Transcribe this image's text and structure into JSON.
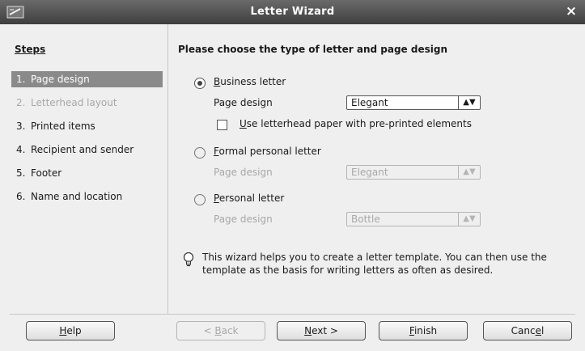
{
  "window": {
    "title": "Letter Wizard",
    "close_icon": "×"
  },
  "steps": {
    "heading": "Steps",
    "items": [
      {
        "num": "1.",
        "label": "Page design",
        "state": "active"
      },
      {
        "num": "2.",
        "label": "Letterhead layout",
        "state": "disabled"
      },
      {
        "num": "3.",
        "label": "Printed items",
        "state": "normal"
      },
      {
        "num": "4.",
        "label": "Recipient and sender",
        "state": "normal"
      },
      {
        "num": "5.",
        "label": "Footer",
        "state": "normal"
      },
      {
        "num": "6.",
        "label": "Name and location",
        "state": "normal"
      }
    ]
  },
  "content": {
    "heading": "Please choose the type of letter and page design",
    "business": {
      "mnemonic": "B",
      "rest": "usiness letter",
      "page_design_label": "Page design",
      "page_design_value": "Elegant",
      "checkbox_mnemonic": "U",
      "checkbox_rest": "se letterhead paper with pre-printed elements"
    },
    "formal": {
      "mnemonic": "F",
      "rest": "ormal personal letter",
      "page_design_label": "Page design",
      "page_design_value": "Elegant"
    },
    "personal": {
      "mnemonic": "P",
      "rest": "ersonal letter",
      "page_design_label": "Page design",
      "page_design_value": "Bottle"
    },
    "info_text": "This wizard helps you to create a letter template. You can then use the template as the basis for writing letters as often as desired."
  },
  "buttons": {
    "help_mn": "H",
    "help_rest": "elp",
    "back_pre": "< ",
    "back_mn": "B",
    "back_rest": "ack",
    "next_mn": "N",
    "next_rest": "ext >",
    "finish_mn": "F",
    "finish_rest": "inish",
    "cancel_pre": "Canc",
    "cancel_mn": "e",
    "cancel_rest": "l"
  },
  "colors": {
    "titlebar": "#4a4a4a",
    "active_step": "#8a8a8a",
    "disabled_text": "#a8a8a8"
  },
  "icons": {
    "app": "wizard-app-icon",
    "info": "lightbulb-icon",
    "select": "spin-arrows-icon"
  }
}
